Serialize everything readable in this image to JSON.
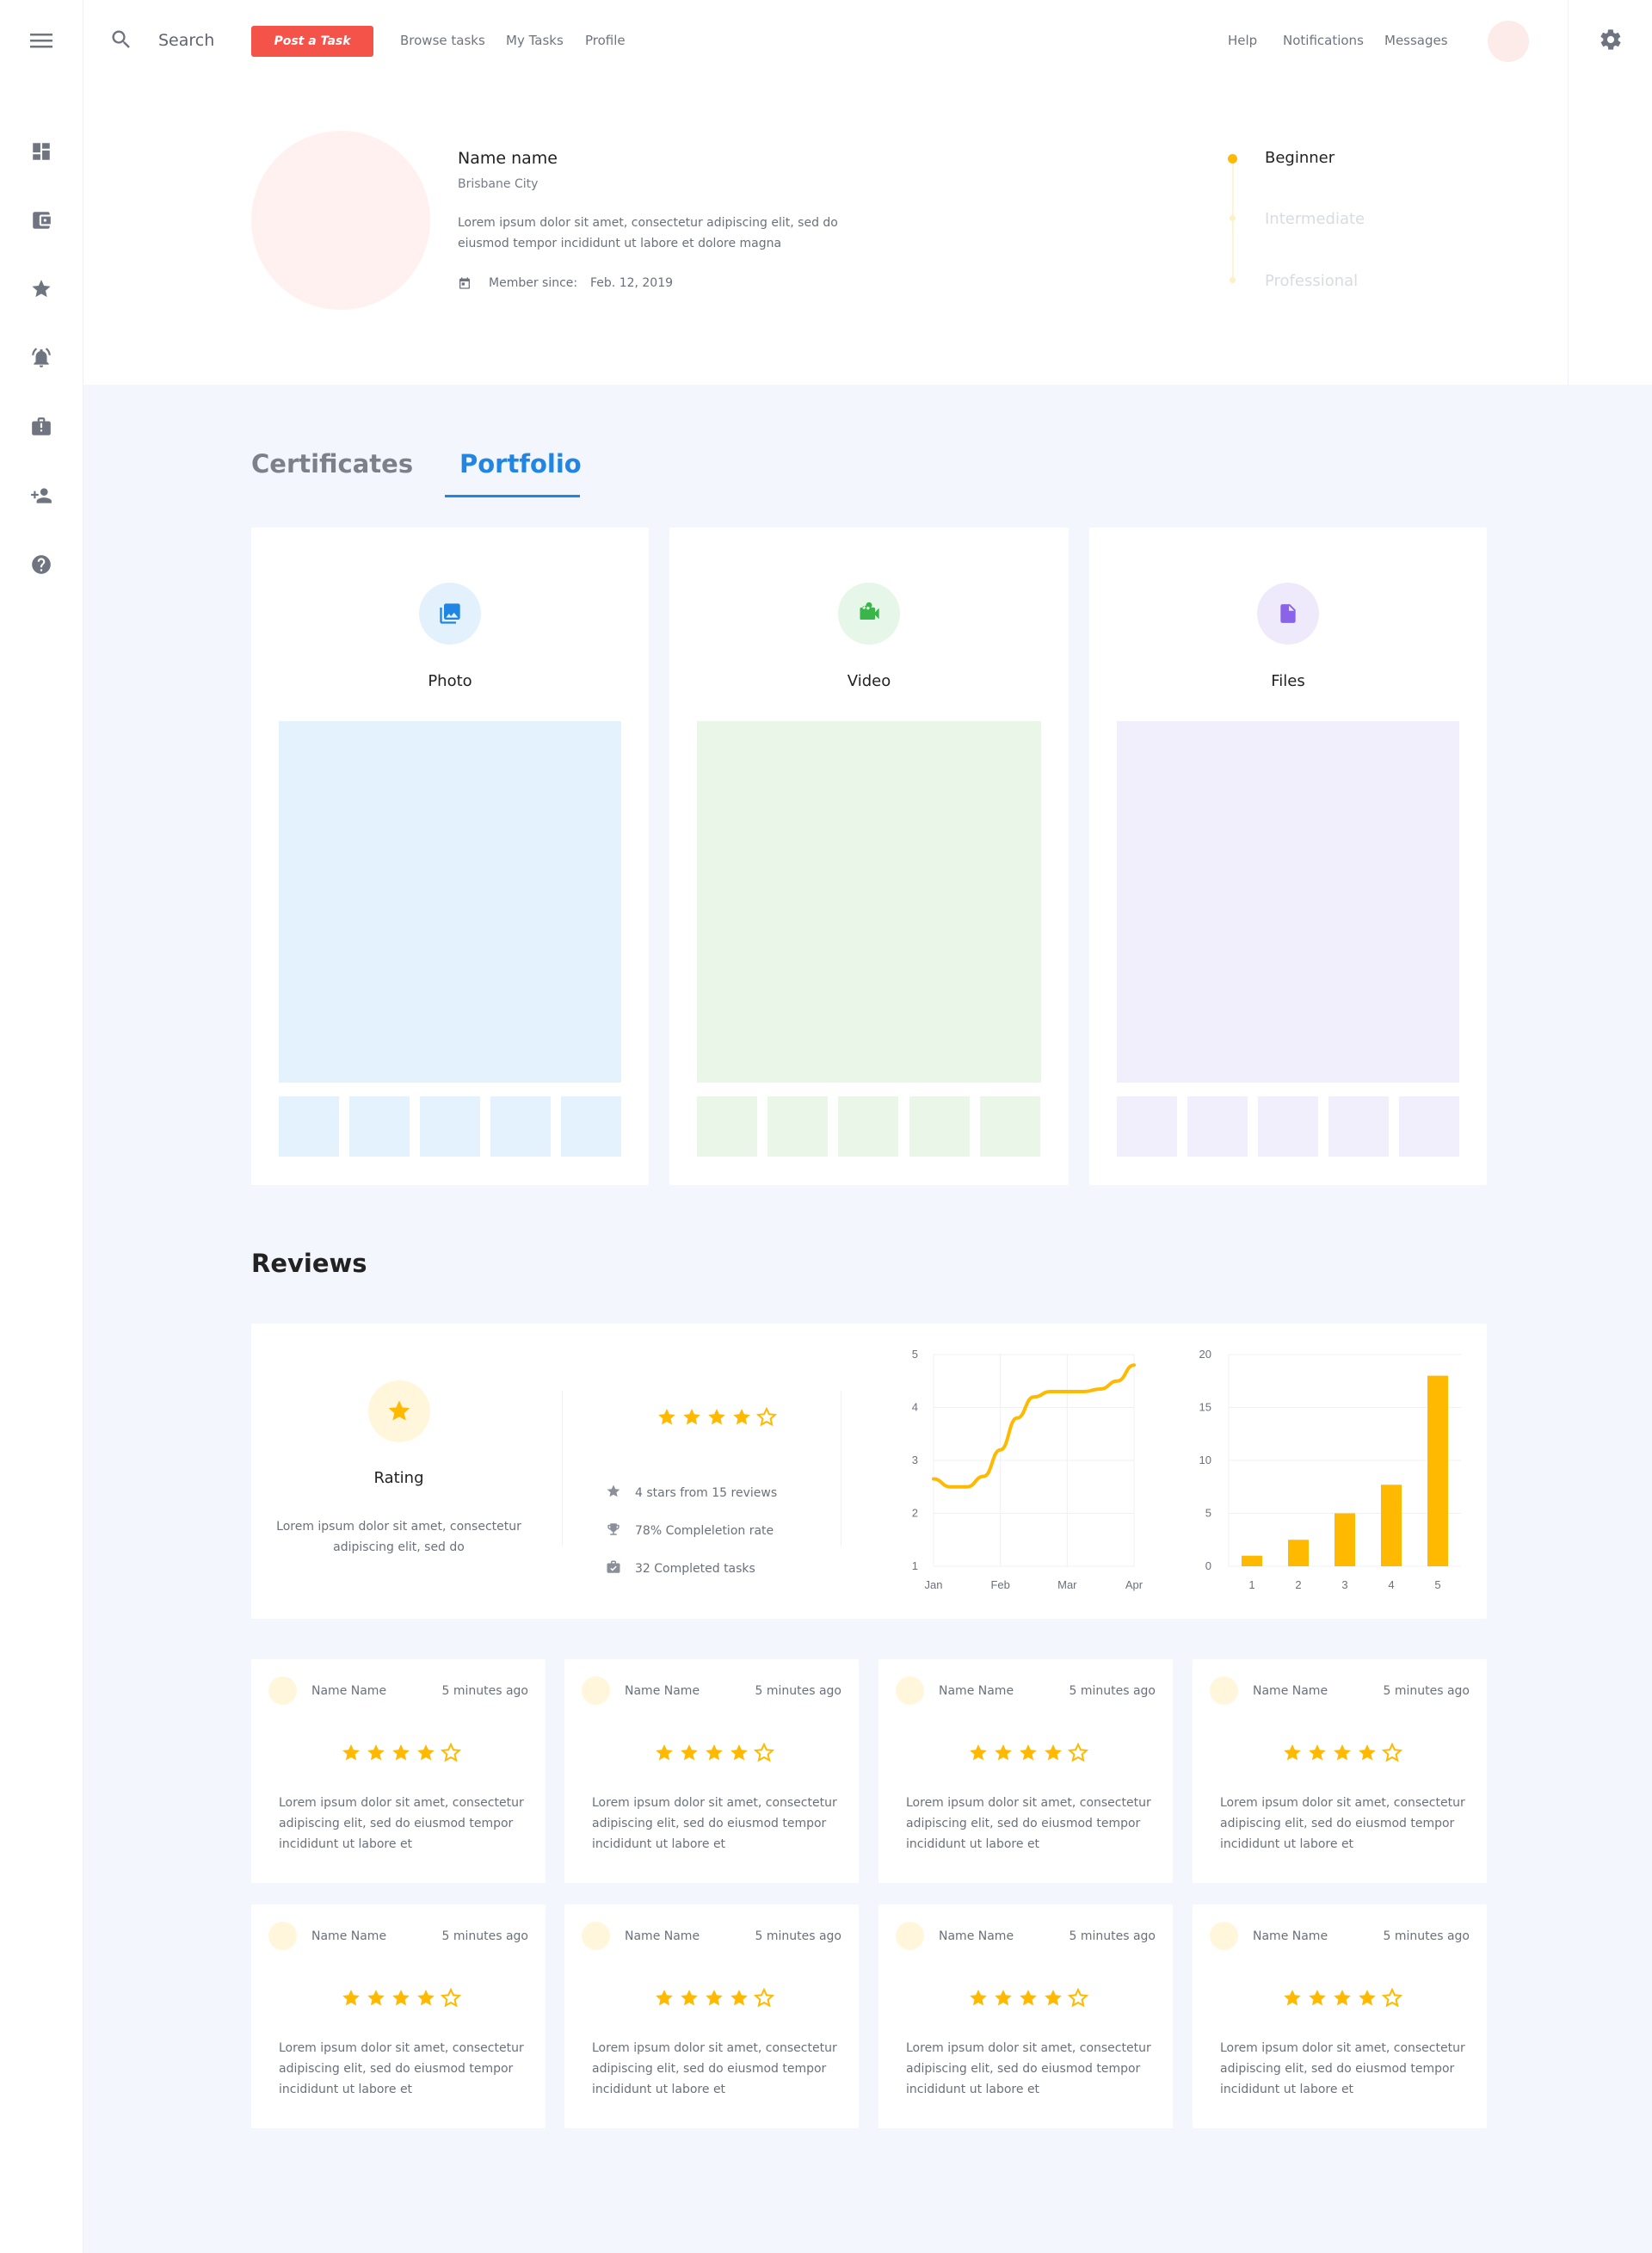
{
  "topbar": {
    "search_label": "Search",
    "post_task_label": "Post a Task",
    "nav_left": [
      "Browse tasks",
      "My Tasks",
      "Profile"
    ],
    "nav_right": [
      "Help",
      "Notifications",
      "Messages"
    ]
  },
  "sidebar": {
    "icons": [
      "menu-icon",
      "dashboard-icon",
      "wallet-icon",
      "star-badge-icon",
      "notification-bell-icon",
      "task-alert-icon",
      "add-user-icon",
      "help-icon"
    ]
  },
  "profile": {
    "name": "Name name",
    "city": "Brisbane City",
    "description": "Lorem ipsum dolor sit amet, consectetur adipiscing elit, sed do eiusmod tempor incididunt ut labore et dolore magna",
    "member_since_label": "Member since:",
    "member_since_date": "Feb. 12, 2019",
    "levels": [
      {
        "label": "Beginner",
        "active": true
      },
      {
        "label": "Intermediate",
        "active": false
      },
      {
        "label": "Professional",
        "active": false
      }
    ]
  },
  "tabs": [
    {
      "label": "Certificates",
      "active": false
    },
    {
      "label": "Portfolio",
      "active": true
    }
  ],
  "portfolio": [
    {
      "title": "Photo",
      "icon": "photo-icon",
      "accent": "#2085e3",
      "icon_bg": "#e3f1fd",
      "fill": "#e4f2fe"
    },
    {
      "title": "Video",
      "icon": "video-camera-icon",
      "accent": "#39b54a",
      "icon_bg": "#e6f6e8",
      "fill": "#eaf7e8"
    },
    {
      "title": "Files",
      "icon": "file-icon",
      "accent": "#8a63e8",
      "icon_bg": "#eeeafc",
      "fill": "#f2effd"
    }
  ],
  "reviews": {
    "title": "Reviews",
    "summary": {
      "rating_label": "Rating",
      "rating_desc": "Lorem ipsum dolor sit amet, consectetur adipiscing elit, sed do",
      "stars": 4,
      "stats": [
        {
          "icon": "star-icon",
          "text": "4 stars from 15 reviews"
        },
        {
          "icon": "trophy-icon",
          "text": "78% Compleletion rate"
        },
        {
          "icon": "briefcase-check-icon",
          "text": "32 Completed tasks"
        }
      ]
    },
    "items": [
      {
        "name": "Name Name",
        "time": "5 minutes ago",
        "stars": 4,
        "text": "Lorem ipsum dolor sit amet, consectetur adipiscing elit, sed do eiusmod tempor incididunt ut labore et"
      },
      {
        "name": "Name Name",
        "time": "5 minutes ago",
        "stars": 4,
        "text": "Lorem ipsum dolor sit amet, consectetur adipiscing elit, sed do eiusmod tempor incididunt ut labore et"
      },
      {
        "name": "Name Name",
        "time": "5 minutes ago",
        "stars": 4,
        "text": "Lorem ipsum dolor sit amet, consectetur adipiscing elit, sed do eiusmod tempor incididunt ut labore et"
      },
      {
        "name": "Name Name",
        "time": "5 minutes ago",
        "stars": 4,
        "text": "Lorem ipsum dolor sit amet, consectetur adipiscing elit, sed do eiusmod tempor incididunt ut labore et"
      },
      {
        "name": "Name Name",
        "time": "5 minutes ago",
        "stars": 4,
        "text": "Lorem ipsum dolor sit amet, consectetur adipiscing elit, sed do eiusmod tempor incididunt ut labore et"
      },
      {
        "name": "Name Name",
        "time": "5 minutes ago",
        "stars": 4,
        "text": "Lorem ipsum dolor sit amet, consectetur adipiscing elit, sed do eiusmod tempor incididunt ut labore et"
      },
      {
        "name": "Name Name",
        "time": "5 minutes ago",
        "stars": 4,
        "text": "Lorem ipsum dolor sit amet, consectetur adipiscing elit, sed do eiusmod tempor incididunt ut labore et"
      },
      {
        "name": "Name Name",
        "time": "5 minutes ago",
        "stars": 4,
        "text": "Lorem ipsum dolor sit amet, consectetur adipiscing elit, sed do eiusmod tempor incididunt ut labore et"
      }
    ]
  },
  "colors": {
    "accent_red": "#f4534a",
    "accent_blue": "#2085e3",
    "star_yellow": "#ffb900",
    "main_bg": "#f3f6fc"
  },
  "chart_data": [
    {
      "type": "line",
      "categories": [
        "Jan",
        "Feb",
        "Mar",
        "Apr"
      ],
      "x": [
        0,
        0.25,
        0.5,
        0.75,
        1.0,
        1.25,
        1.5,
        1.75,
        2.0,
        2.25,
        2.5,
        2.75,
        3.0
      ],
      "series": [
        {
          "values": [
            2.65,
            2.5,
            2.5,
            2.7,
            3.2,
            3.8,
            4.2,
            4.3,
            4.3,
            4.3,
            4.35,
            4.5,
            4.8
          ]
        }
      ],
      "ylim": [
        1,
        5
      ],
      "yticks": [
        1,
        2,
        3,
        4,
        5
      ],
      "grid": true,
      "color": "#ffb900"
    },
    {
      "type": "bar",
      "categories": [
        "1",
        "2",
        "3",
        "4",
        "5"
      ],
      "values": [
        1,
        2.5,
        5,
        7.7,
        18
      ],
      "ylim": [
        0,
        20
      ],
      "yticks": [
        0,
        5,
        10,
        15,
        20
      ],
      "grid": true,
      "color": "#ffb900"
    }
  ]
}
